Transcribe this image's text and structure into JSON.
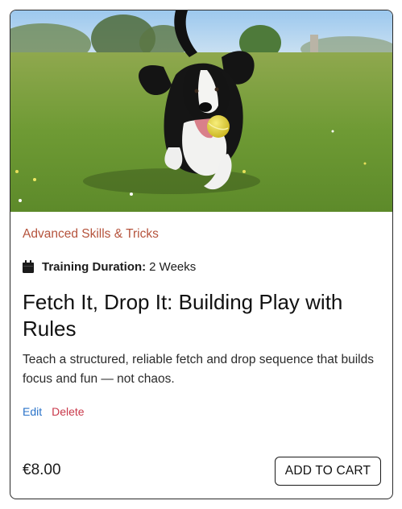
{
  "product": {
    "image_alt": "Black and white dog running on grass with a yellow ball in its mouth",
    "category": "Advanced Skills & Tricks",
    "duration_label": "Training Duration:",
    "duration_value": "2 Weeks",
    "title": "Fetch It, Drop It: Building Play with Rules",
    "description": "Teach a structured, reliable fetch and drop sequence that builds focus and fun — not chaos.",
    "price": "€8.00"
  },
  "actions": {
    "edit_label": "Edit",
    "delete_label": "Delete",
    "add_to_cart_label": "ADD TO CART"
  },
  "icons": {
    "duration": "calendar-icon"
  },
  "colors": {
    "category": "#b5533c",
    "edit": "#2a73c9",
    "delete": "#c9384a",
    "border": "#2a2a2a"
  }
}
